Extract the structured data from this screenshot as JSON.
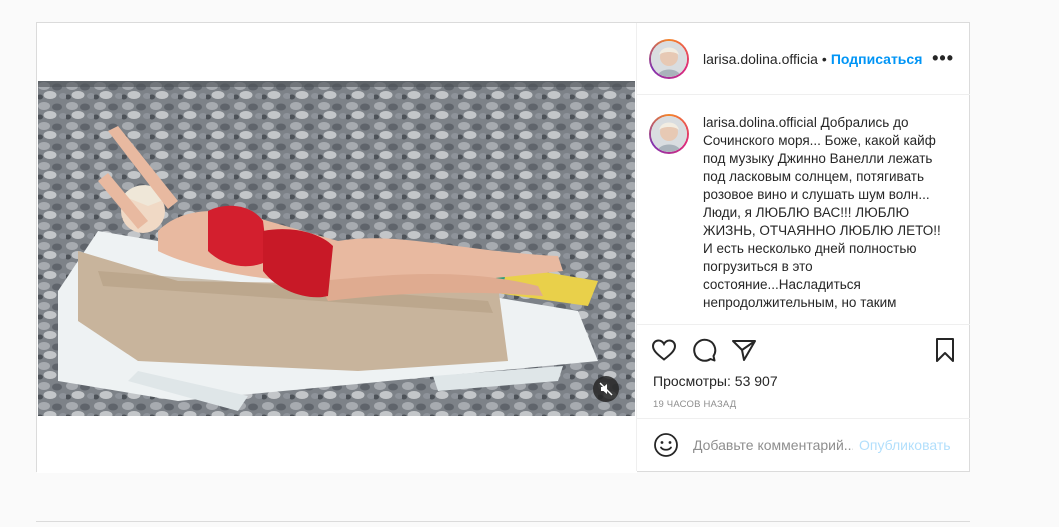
{
  "post": {
    "username": "larisa.dolina.officia",
    "separator": "•",
    "follow_label": "Подписаться",
    "more_label": "•••"
  },
  "caption": {
    "username": "larisa.dolina.official",
    "text": " Добрались до Сочинского моря... Боже, какой кайф под музыку Джинно Ванелли лежать под ласковым солнцем, потягивать розовое вино и слушать шум волн... Люди, я ЛЮБЛЮ ВАС!!! ЛЮБЛЮ ЖИЗНЬ, ОТЧАЯННО ЛЮБЛЮ ЛЕТО!! И есть несколько дней полностью погрузиться в это состояние...Насладиться непродолжительным, но таким"
  },
  "stats": {
    "views": "Просмотры: 53 907",
    "timestamp": "19 ЧАСОВ НАЗАД"
  },
  "comment": {
    "placeholder": "Добавьте комментарий...",
    "publish_label": "Опубликовать"
  },
  "icons": {
    "like": "heart-icon",
    "comment": "comment-icon",
    "share": "paper-plane-icon",
    "save": "bookmark-icon",
    "emoji": "smiley-icon",
    "more": "ellipsis-icon",
    "mute": "speaker-muted-icon"
  },
  "colors": {
    "accent": "#0095f6",
    "publish_disabled": "#b2dffc",
    "border": "#dbdbdb",
    "muted_text": "#8e8e8e"
  }
}
